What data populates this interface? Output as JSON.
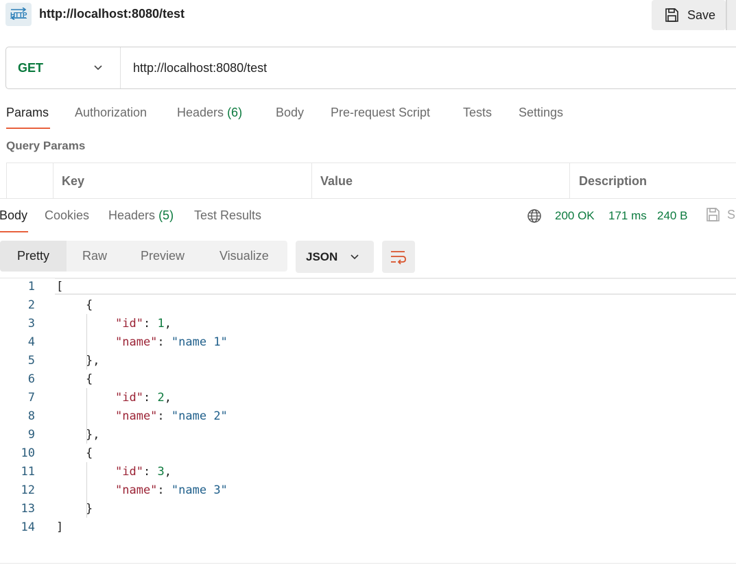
{
  "request": {
    "title": "http://localhost:8080/test",
    "icon_text": "HTTP",
    "save_label": "Save",
    "method": "GET",
    "url": "http://localhost:8080/test"
  },
  "request_tabs": [
    {
      "label": "Params",
      "count": ""
    },
    {
      "label": "Authorization",
      "count": ""
    },
    {
      "label": "Headers",
      "count": "(6)"
    },
    {
      "label": "Body",
      "count": ""
    },
    {
      "label": "Pre-request Script",
      "count": ""
    },
    {
      "label": "Tests",
      "count": ""
    },
    {
      "label": "Settings",
      "count": ""
    }
  ],
  "query_params": {
    "title": "Query Params",
    "columns": [
      "Key",
      "Value",
      "Description"
    ]
  },
  "response_tabs": [
    {
      "label": "Body",
      "count": ""
    },
    {
      "label": "Cookies",
      "count": ""
    },
    {
      "label": "Headers",
      "count": "(5)"
    },
    {
      "label": "Test Results",
      "count": ""
    }
  ],
  "response_status": {
    "status": "200 OK",
    "time": "171 ms",
    "size": "240 B",
    "save_label": "S"
  },
  "view_modes": [
    "Pretty",
    "Raw",
    "Preview",
    "Visualize"
  ],
  "format": "JSON",
  "code_lines": [
    {
      "n": "1",
      "indent": 0,
      "text": "["
    },
    {
      "n": "2",
      "indent": 1,
      "text": "{"
    },
    {
      "n": "3",
      "indent": 2,
      "key": "\"id\"",
      "value": "1",
      "type": "num",
      "comma": ","
    },
    {
      "n": "4",
      "indent": 2,
      "key": "\"name\"",
      "value": "\"name 1\"",
      "type": "str",
      "comma": ""
    },
    {
      "n": "5",
      "indent": 1,
      "text": "},"
    },
    {
      "n": "6",
      "indent": 1,
      "text": "{"
    },
    {
      "n": "7",
      "indent": 2,
      "key": "\"id\"",
      "value": "2",
      "type": "num",
      "comma": ","
    },
    {
      "n": "8",
      "indent": 2,
      "key": "\"name\"",
      "value": "\"name 2\"",
      "type": "str",
      "comma": ""
    },
    {
      "n": "9",
      "indent": 1,
      "text": "},"
    },
    {
      "n": "10",
      "indent": 1,
      "text": "{"
    },
    {
      "n": "11",
      "indent": 2,
      "key": "\"id\"",
      "value": "3",
      "type": "num",
      "comma": ","
    },
    {
      "n": "12",
      "indent": 2,
      "key": "\"name\"",
      "value": "\"name 3\"",
      "type": "str",
      "comma": ""
    },
    {
      "n": "13",
      "indent": 1,
      "text": "}"
    },
    {
      "n": "14",
      "indent": 0,
      "text": "]"
    }
  ],
  "colors": {
    "accent": "#e8603c",
    "method_get": "#0b7a3e",
    "status_ok": "#0b7a3e",
    "json_key": "#9b2335",
    "json_string": "#1f5f8b",
    "json_number": "#0e7a3e"
  },
  "icons": [
    "http-request-icon",
    "save-icon",
    "chevron-down-icon",
    "globe-icon",
    "wrap-lines-icon"
  ]
}
